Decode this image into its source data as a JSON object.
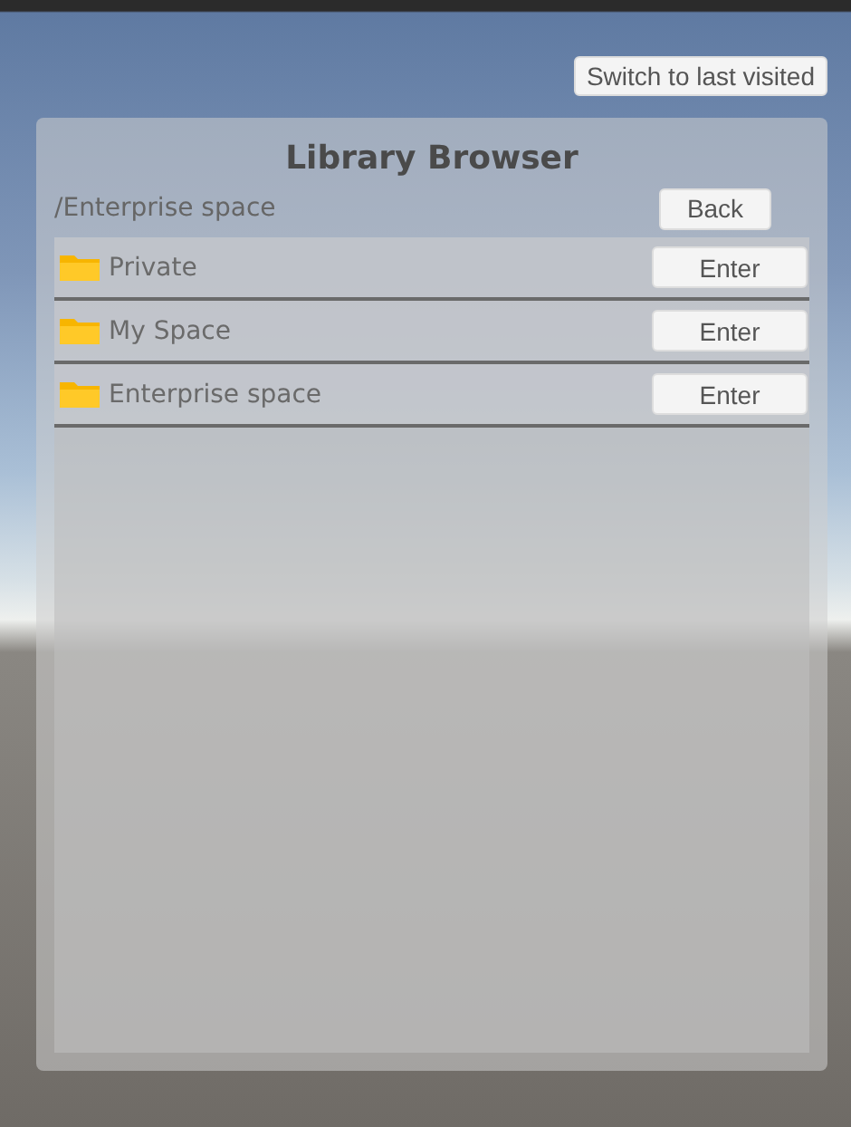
{
  "top_button": "Switch to last visited",
  "panel": {
    "title": "Library Browser",
    "path": "/Enterprise space",
    "back_button": "Back",
    "items": [
      {
        "name": "Private",
        "button": "Enter"
      },
      {
        "name": "My Space",
        "button": "Enter"
      },
      {
        "name": "Enterprise space",
        "button": "Enter"
      }
    ]
  }
}
